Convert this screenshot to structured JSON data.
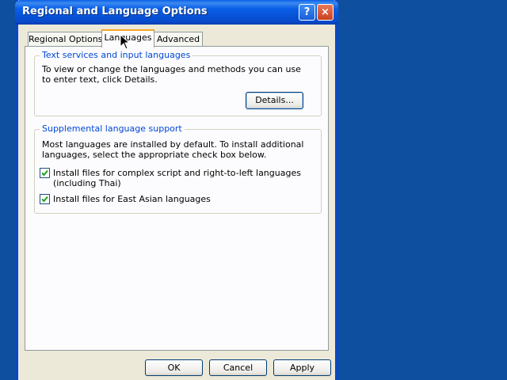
{
  "window": {
    "title": "Regional and Language Options",
    "help_label": "?",
    "close_label": "×"
  },
  "tabs": [
    {
      "label": "Regional Options",
      "active": false
    },
    {
      "label": "Languages",
      "active": true
    },
    {
      "label": "Advanced",
      "active": false
    }
  ],
  "text_services": {
    "title": "Text services and input languages",
    "description": "To view or change the languages and methods you can use to enter text, click Details.",
    "details_button": "Details..."
  },
  "supplemental": {
    "title": "Supplemental language support",
    "description": "Most languages are installed by default. To install additional languages, select the appropriate check box below.",
    "options": [
      {
        "label": "Install files for complex script and right-to-left languages (including Thai)",
        "checked": true
      },
      {
        "label": "Install files for East Asian languages",
        "checked": true
      }
    ]
  },
  "footer": {
    "ok": "OK",
    "cancel": "Cancel",
    "apply": "Apply"
  },
  "colors": {
    "desktop": "#0e4fa0",
    "titlebar": "#0a5fe8",
    "group_title": "#0046d5",
    "dialog_bg": "#ece9d8",
    "checkmark": "#21a121"
  }
}
